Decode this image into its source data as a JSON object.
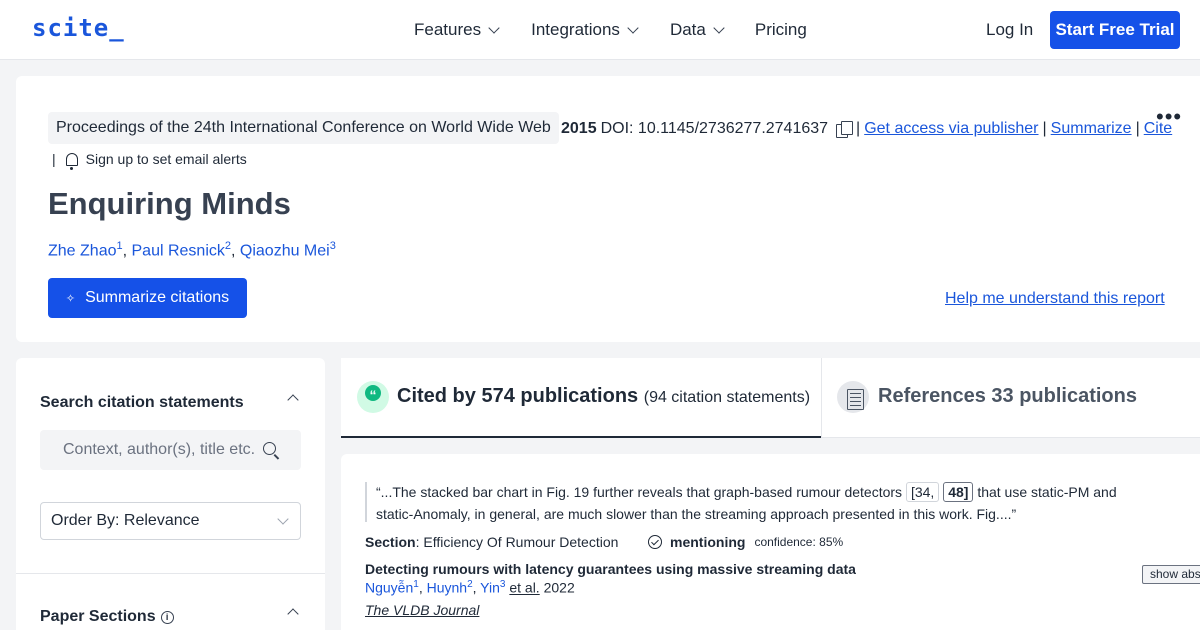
{
  "header": {
    "logo": "scite_",
    "nav": [
      "Features",
      "Integrations",
      "Data",
      "Pricing"
    ],
    "login": "Log In",
    "trial": "Start Free Trial"
  },
  "paper": {
    "venue": "Proceedings of the 24th International Conference on World Wide Web",
    "year": "2015",
    "doi": "DOI: 10.1145/2736277.2741637",
    "links": [
      "Get access via publisher",
      "Summarize",
      "Cite"
    ],
    "alerts": "Sign up to set email alerts",
    "title": "Enquiring Minds",
    "authors": [
      {
        "name": "Zhe Zhao",
        "sup": "1"
      },
      {
        "name": "Paul Resnick",
        "sup": "2"
      },
      {
        "name": "Qiaozhu Mei",
        "sup": "3"
      }
    ],
    "summarize_button": "Summarize citations",
    "help_link": "Help me understand this report"
  },
  "sidebar": {
    "search_title": "Search citation statements",
    "search_placeholder": "Context, author(s), title etc.",
    "order_by": "Order By: Relevance",
    "sections_title": "Paper Sections"
  },
  "tabs": {
    "cited_by": "Cited by 574 publications",
    "cited_by_statements": "(94 citation statements)",
    "references": "References 33 publications"
  },
  "citation": {
    "quote_start": "“...The stacked bar chart in Fig. 19 further reveals that graph-based rumour detectors",
    "ref1": "[34,",
    "ref2": "48]",
    "quote_end": "that use static-PM and static-Anomaly, in general, are much slower than the streaming approach presented in this work. Fig....”",
    "section_label": "Section",
    "section_value": ": Efficiency Of Rumour Detection",
    "type": "mentioning",
    "confidence": "confidence: 85%",
    "title": "Detecting rumours with latency guarantees using massive streaming data",
    "authors": [
      {
        "name": "Nguyễn",
        "sup": "1"
      },
      {
        "name": "Huynh",
        "sup": "2"
      },
      {
        "name": "Yin",
        "sup": "3"
      }
    ],
    "et_al": "et al.",
    "year": "2022",
    "journal": "The VLDB Journal",
    "show_abstract": "show abstract"
  }
}
